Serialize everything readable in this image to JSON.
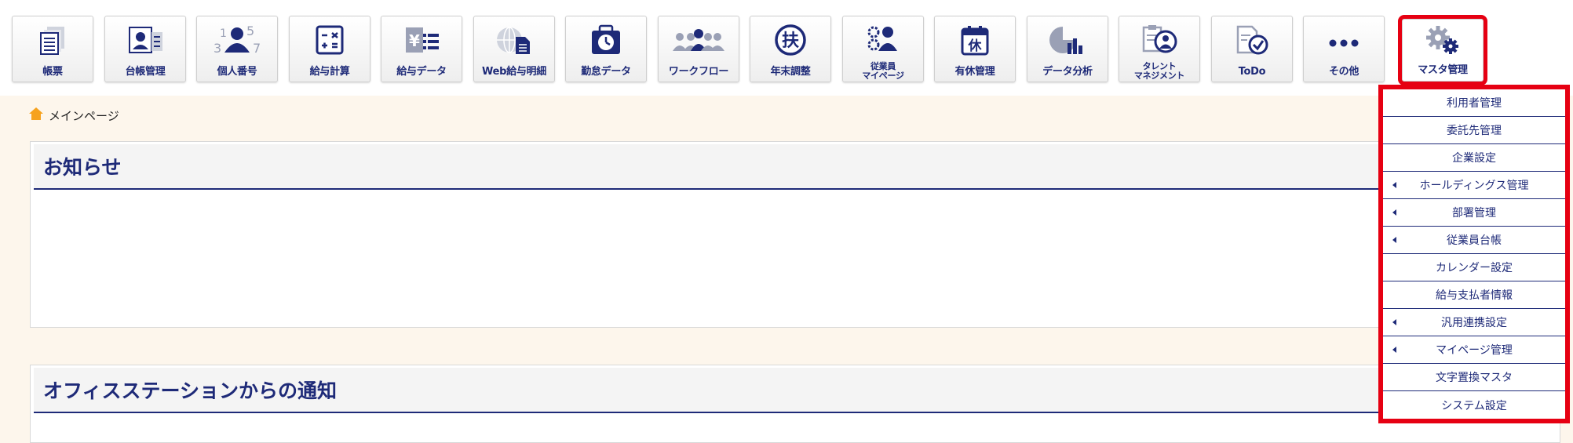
{
  "toolbar": {
    "items": [
      {
        "label": "帳票",
        "icon": "document-stack-icon"
      },
      {
        "label": "台帳管理",
        "icon": "id-card-icon"
      },
      {
        "label": "個人番号",
        "icon": "person-number-icon"
      },
      {
        "label": "給与計算",
        "icon": "calculator-icon"
      },
      {
        "label": "給与データ",
        "icon": "yen-data-icon"
      },
      {
        "label": "Web給与明細",
        "icon": "globe-document-icon"
      },
      {
        "label": "勤怠データ",
        "icon": "clock-bag-icon"
      },
      {
        "label": "ワークフロー",
        "icon": "people-group-icon"
      },
      {
        "label": "年末調整",
        "icon": "fu-circle-icon"
      },
      {
        "label": "従業員\nマイページ",
        "icon": "employee-gear-icon"
      },
      {
        "label": "有休管理",
        "icon": "calendar-holiday-icon"
      },
      {
        "label": "データ分析",
        "icon": "pie-bar-chart-icon"
      },
      {
        "label": "タレント\nマネジメント",
        "icon": "clipboard-person-icon"
      },
      {
        "label": "ToDo",
        "icon": "checklist-icon"
      },
      {
        "label": "その他",
        "icon": "more-dots-icon"
      },
      {
        "label": "マスタ管理",
        "icon": "gears-icon"
      }
    ],
    "holiday_glyph": "休",
    "fu_glyph": "扶",
    "yen_glyph": "¥",
    "number_glyphs": [
      "1",
      "5",
      "3",
      "7"
    ]
  },
  "breadcrumb": {
    "icon": "home-icon",
    "label": "メインページ"
  },
  "panels": [
    {
      "title": "お知らせ"
    },
    {
      "title": "オフィスステーションからの通知"
    }
  ],
  "master_menu": {
    "items": [
      {
        "label": "利用者管理",
        "submenu": false
      },
      {
        "label": "委託先管理",
        "submenu": false
      },
      {
        "label": "企業設定",
        "submenu": false
      },
      {
        "label": "ホールディングス管理",
        "submenu": true
      },
      {
        "label": "部署管理",
        "submenu": true
      },
      {
        "label": "従業員台帳",
        "submenu": true
      },
      {
        "label": "カレンダー設定",
        "submenu": false
      },
      {
        "label": "給与支払者情報",
        "submenu": false
      },
      {
        "label": "汎用連携設定",
        "submenu": true
      },
      {
        "label": "マイページ管理",
        "submenu": true
      },
      {
        "label": "文字置換マスタ",
        "submenu": false
      },
      {
        "label": "システム設定",
        "submenu": false
      }
    ]
  },
  "colors": {
    "accent_navy": "#1e2a78",
    "highlight_red": "#e60012",
    "home_icon_orange": "#f6a21e",
    "page_background": "#fdf6ec"
  }
}
